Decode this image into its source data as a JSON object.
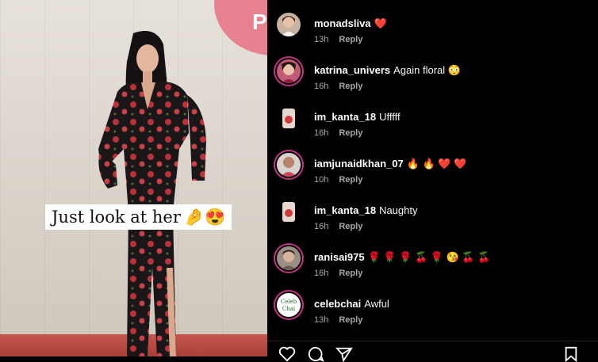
{
  "post": {
    "caption": "Just look at her",
    "caption_emojis": "🤌😍",
    "sign_letter": "P"
  },
  "comments": [
    {
      "user": "monadsliva",
      "text": "❤️",
      "time": "13h",
      "reply": "Reply"
    },
    {
      "user": "katrina_univers",
      "text": "Again floral 😳",
      "time": "16h",
      "reply": "Reply"
    },
    {
      "user": "im_kanta_18",
      "text": "Ufffff",
      "time": "16h",
      "reply": "Reply"
    },
    {
      "user": "iamjunaidkhan_07",
      "text": "🔥 🔥 ❤️ ❤️",
      "time": "10h",
      "reply": "Reply"
    },
    {
      "user": "im_kanta_18",
      "text": "Naughty",
      "time": "16h",
      "reply": "Reply"
    },
    {
      "user": "ranisai975",
      "text": "🌹 🌹 🌹 🍒 🌹 😘 🍒 🍒",
      "time": "16h",
      "reply": "Reply"
    },
    {
      "user": "celebchai",
      "text": "Awful",
      "time": "13h",
      "reply": "Reply"
    }
  ],
  "avatars": {
    "celebchai_label": "Celeb Chai"
  },
  "icons": [
    "heart-icon",
    "comment-icon",
    "share-icon",
    "bookmark-icon"
  ],
  "colors": {
    "background": "#000000",
    "story_ring": "#c13584",
    "meta": "#a8a8a8"
  }
}
